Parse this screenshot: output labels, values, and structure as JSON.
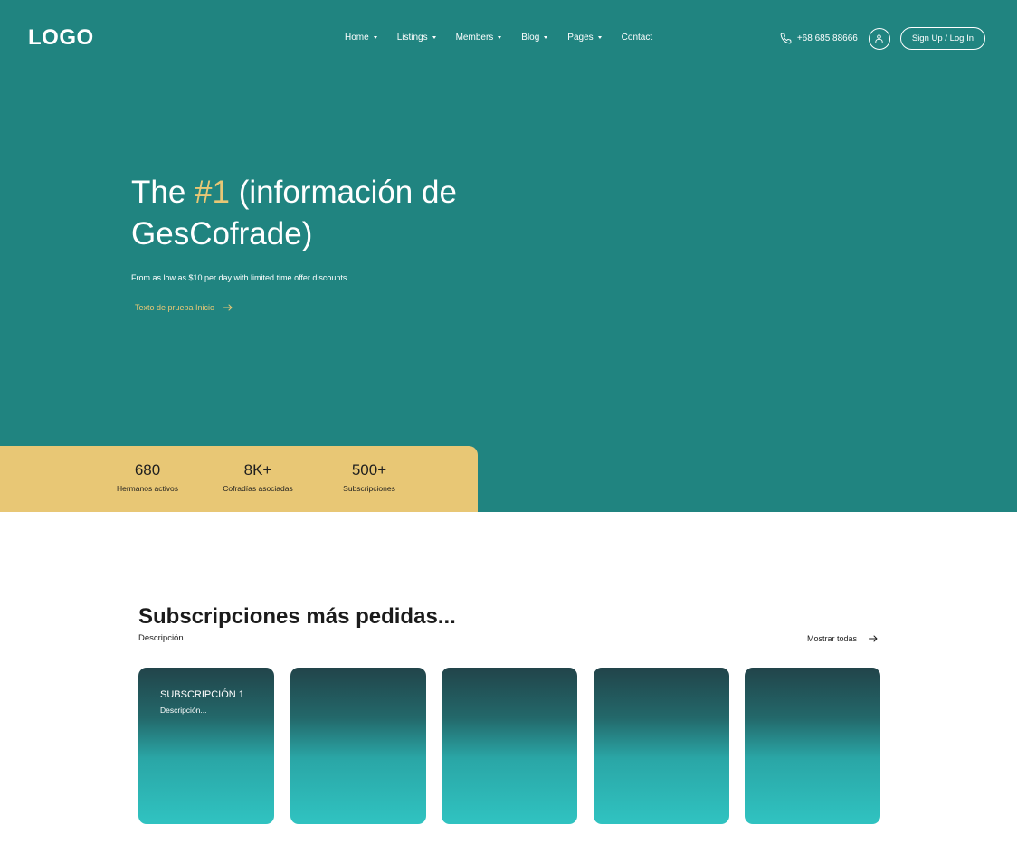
{
  "header": {
    "logo": "LOGO",
    "nav": [
      {
        "label": "Home",
        "dropdown": true
      },
      {
        "label": "Listings",
        "dropdown": true
      },
      {
        "label": "Members",
        "dropdown": true
      },
      {
        "label": "Blog",
        "dropdown": true
      },
      {
        "label": "Pages",
        "dropdown": true
      },
      {
        "label": "Contact",
        "dropdown": false
      }
    ],
    "phone": "+68 685 88666",
    "signup_label": "Sign Up / Log In"
  },
  "hero": {
    "title_prefix": "The ",
    "title_accent": "#1",
    "title_suffix": " (información de GesCofrade)",
    "subtitle": "From as low as $10 per day with limited time offer discounts.",
    "cta_label": "Texto de prueba Inicio"
  },
  "stats": [
    {
      "value": "680",
      "label": "Hermanos activos"
    },
    {
      "value": "8K+",
      "label": "Cofradías asociadas"
    },
    {
      "value": "500+",
      "label": "Subscripciones"
    }
  ],
  "subscriptions": {
    "title": "Subscripciones más pedidas...",
    "description": "Descripción...",
    "show_all_label": "Mostrar todas",
    "cards": [
      {
        "title": "SUBSCRIPCIÓN 1",
        "description": "Descripción..."
      },
      {
        "title": "",
        "description": ""
      },
      {
        "title": "",
        "description": ""
      },
      {
        "title": "",
        "description": ""
      },
      {
        "title": "",
        "description": ""
      }
    ]
  },
  "colors": {
    "primary": "#208480",
    "accent": "#e8c775",
    "card_gradient_top": "#22444a",
    "card_gradient_bottom": "#30c3c1"
  },
  "icons": {
    "phone": "phone-icon",
    "user": "user-icon",
    "arrow": "arrow-right-icon",
    "caret": "caret-down-icon"
  }
}
